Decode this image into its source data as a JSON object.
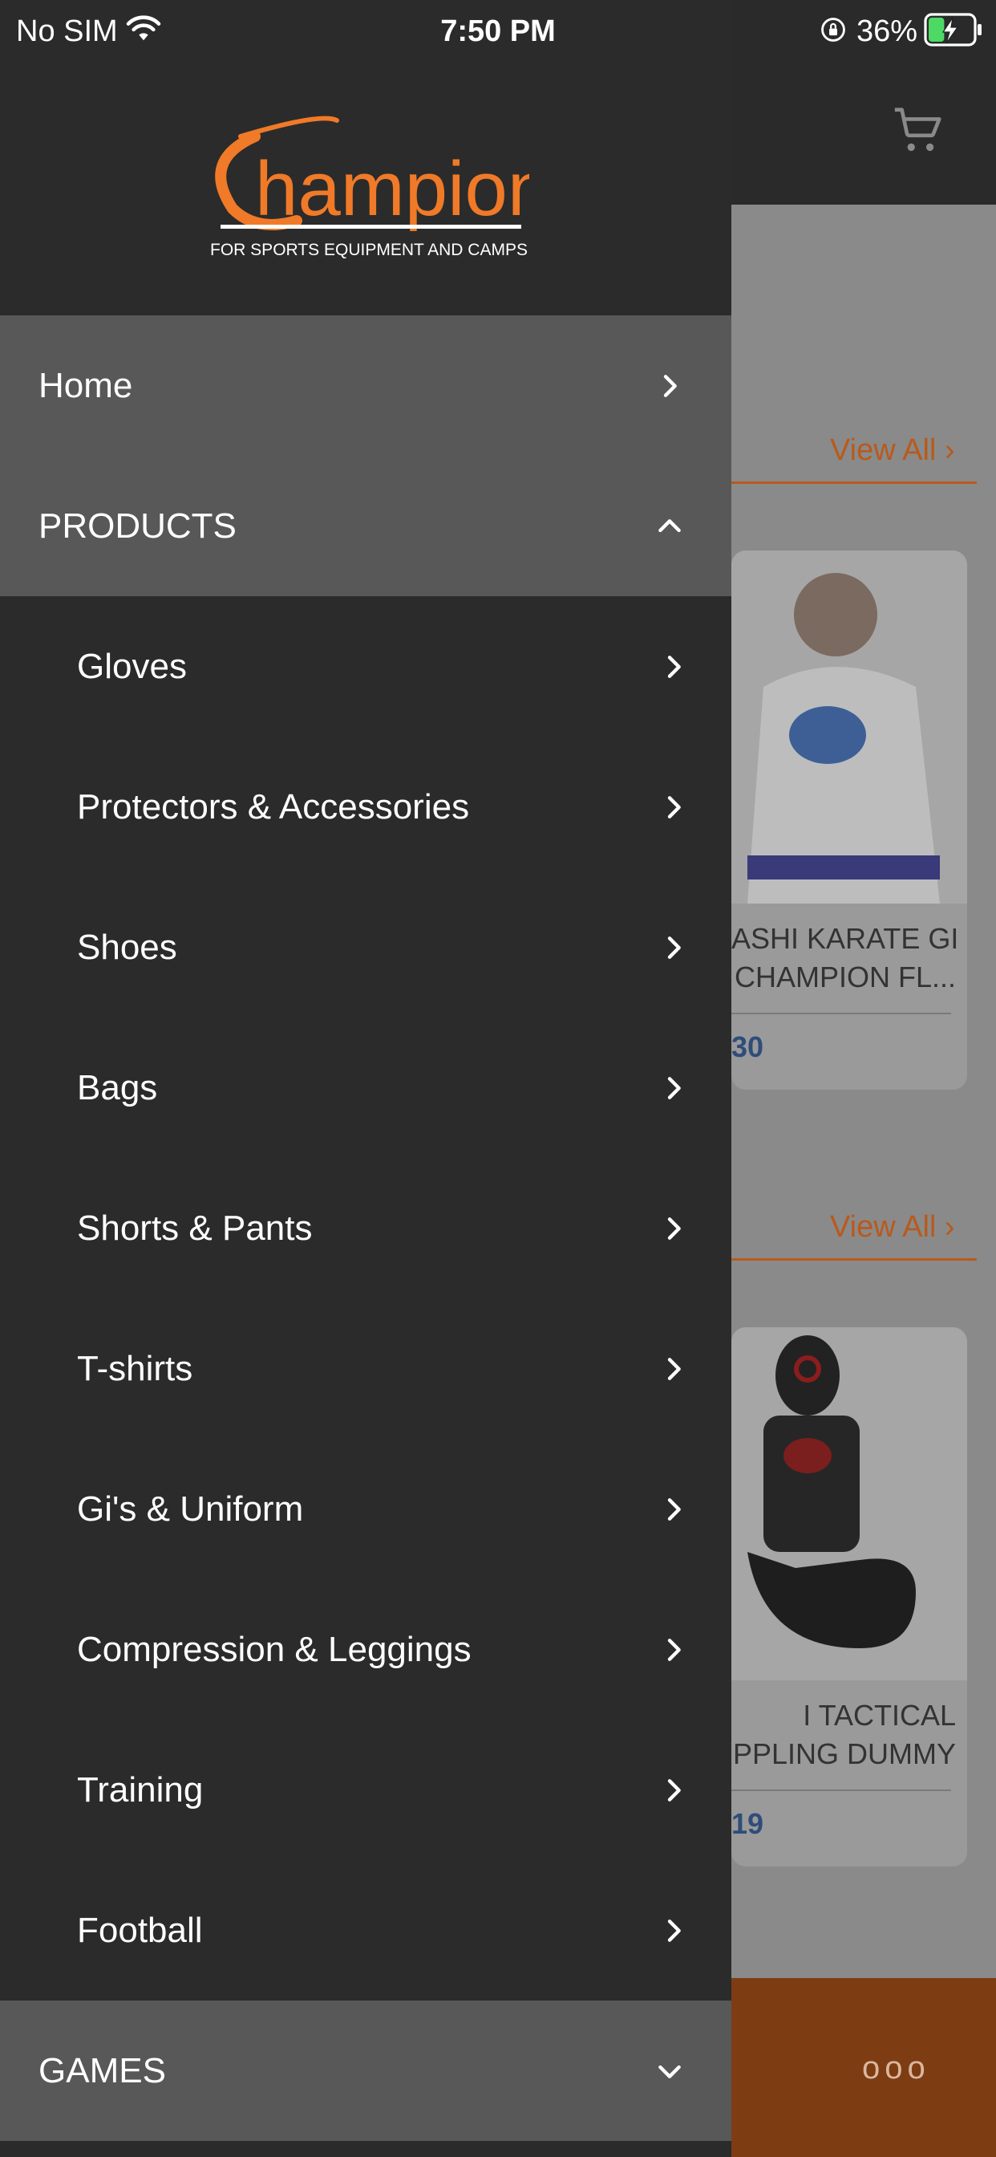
{
  "status_bar": {
    "carrier": "No SIM",
    "time": "7:50 PM",
    "battery_percent": "36%",
    "battery_level": 0.36,
    "icons": [
      "wifi-icon",
      "orientation-lock-icon",
      "battery-charging-icon"
    ]
  },
  "background": {
    "sections": [
      {
        "view_all": "View All",
        "product_name_lines": [
          "ASHI KARATE GI",
          "CHAMPION FL..."
        ],
        "price": "30"
      },
      {
        "view_all": "View All",
        "product_name_lines": [
          "I TACTICAL",
          "PPLING DUMMY"
        ],
        "price": "19"
      }
    ],
    "more_icon": "ooo",
    "cart_icon": "cart-icon"
  },
  "drawer": {
    "logo": {
      "wordmark": "Champion",
      "tagline": "FOR SPORTS EQUIPMENT AND CAMPS"
    },
    "items": [
      {
        "label": "Home",
        "icon": "chevron-right-icon"
      },
      {
        "label": "PRODUCTS",
        "icon": "chevron-up-icon"
      },
      {
        "label": "Gloves",
        "icon": "chevron-right-icon"
      },
      {
        "label": "Protectors & Accessories",
        "icon": "chevron-right-icon"
      },
      {
        "label": "Shoes",
        "icon": "chevron-right-icon"
      },
      {
        "label": "Bags",
        "icon": "chevron-right-icon"
      },
      {
        "label": "Shorts & Pants",
        "icon": "chevron-right-icon"
      },
      {
        "label": "T-shirts",
        "icon": "chevron-right-icon"
      },
      {
        "label": "Gi's & Uniform",
        "icon": "chevron-right-icon"
      },
      {
        "label": "Compression & Leggings",
        "icon": "chevron-right-icon"
      },
      {
        "label": "Training",
        "icon": "chevron-right-icon"
      },
      {
        "label": "Football",
        "icon": "chevron-right-icon"
      },
      {
        "label": "GAMES",
        "icon": "chevron-down-icon"
      }
    ]
  },
  "colors": {
    "brand_orange": "#f07a28",
    "drawer_bg": "#2b2b2b",
    "drawer_header_row": "#585858"
  }
}
